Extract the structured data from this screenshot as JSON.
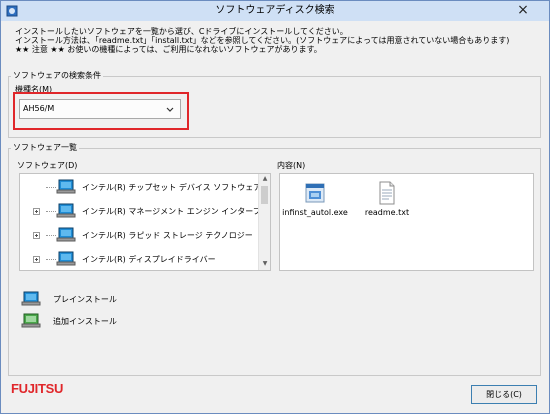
{
  "window": {
    "title": "ソフトウェアディスク検索",
    "close_glyph": "×"
  },
  "info": {
    "line1": "インストールしたいソフトウェアを一覧から選び、Cドライブにインストールしてください。",
    "line2": "インストール方法は、「readme.txt」「install.txt」などを参照してください。(ソフトウェアによっては用意されていない場合もあります)",
    "line3": "★★ 注意 ★★ お使いの機種によっては、ご利用になれないソフトウェアがあります。"
  },
  "search_group": {
    "label": "ソフトウェアの検索条件",
    "model_label": "機種名(M)",
    "model_value": "AH56/M",
    "highlight_color": "#e0262a"
  },
  "list_group": {
    "label": "ソフトウェア一覧",
    "software_label": "ソフトウェア(D)",
    "content_label": "内容(N)",
    "software_items": [
      {
        "label": "インテル(R) チップセット デバイス ソフトウェア",
        "icon": "laptop-preinstall-icon"
      },
      {
        "label": "インテル(R) マネージメント エンジン インターフェイ",
        "icon": "laptop-preinstall-icon"
      },
      {
        "label": "インテル(R) ラピッド ストレージ テクノロジー",
        "icon": "laptop-preinstall-icon"
      },
      {
        "label": "インテル(R) ディスプレイドライバー",
        "icon": "laptop-preinstall-icon"
      }
    ],
    "files": [
      {
        "name": "infinst_autol.exe",
        "icon": "exe-file-icon"
      },
      {
        "name": "readme.txt",
        "icon": "text-file-icon"
      }
    ]
  },
  "legend": {
    "preinstall": "プレインストール",
    "additional": "追加インストール"
  },
  "brand": "FUJITSU",
  "close_button": "閉じる(C)"
}
